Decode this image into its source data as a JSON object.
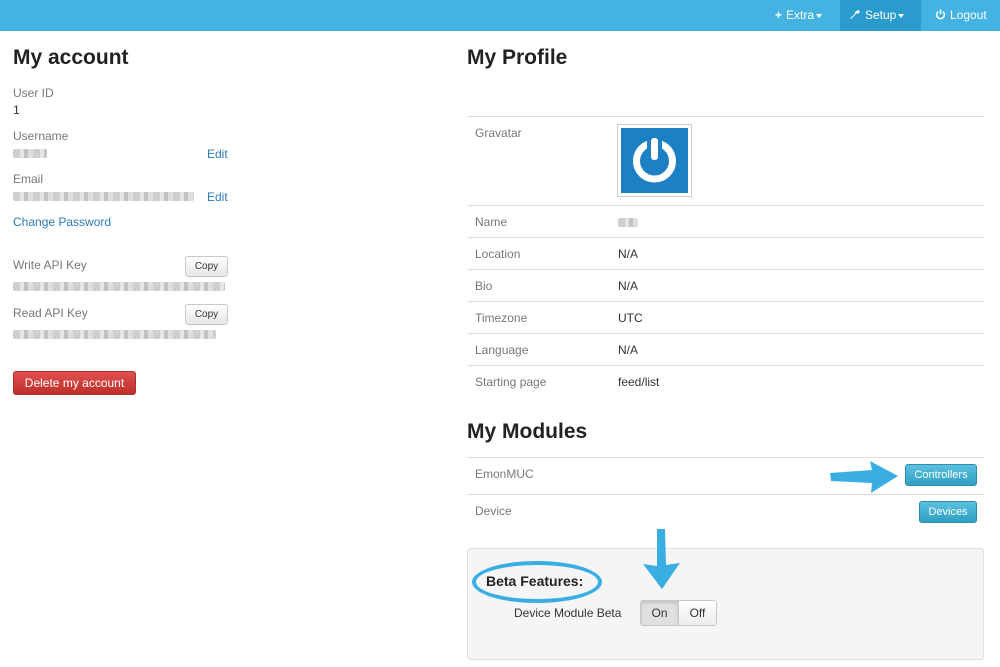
{
  "nav": {
    "extra_label": "Extra",
    "setup_label": "Setup",
    "logout_label": "Logout"
  },
  "account": {
    "title": "My account",
    "user_id_label": "User ID",
    "user_id_value": "1",
    "username_label": "Username",
    "username_edit": "Edit",
    "email_label": "Email",
    "email_edit": "Edit",
    "change_password": "Change Password",
    "write_api_label": "Write API Key",
    "read_api_label": "Read API Key",
    "copy_label": "Copy",
    "delete_label": "Delete my account"
  },
  "profile": {
    "title": "My Profile",
    "rows": [
      {
        "label": "Gravatar"
      },
      {
        "label": "Name"
      },
      {
        "label": "Location",
        "value": "N/A"
      },
      {
        "label": "Bio",
        "value": "N/A"
      },
      {
        "label": "Timezone",
        "value": "UTC"
      },
      {
        "label": "Language",
        "value": "N/A"
      },
      {
        "label": "Starting page",
        "value": "feed/list"
      }
    ]
  },
  "modules": {
    "title": "My Modules",
    "items": [
      {
        "name": "EmonMUC",
        "button": "Controllers"
      },
      {
        "name": "Device",
        "button": "Devices"
      }
    ]
  },
  "beta": {
    "title": "Beta Features:",
    "device_module_label": "Device Module Beta",
    "on_label": "On",
    "off_label": "Off",
    "selected": "On"
  },
  "colors": {
    "navbar": "#44b3e2",
    "annotation": "#3aaee2",
    "danger": "#c9302c",
    "info": "#5bc0de"
  }
}
